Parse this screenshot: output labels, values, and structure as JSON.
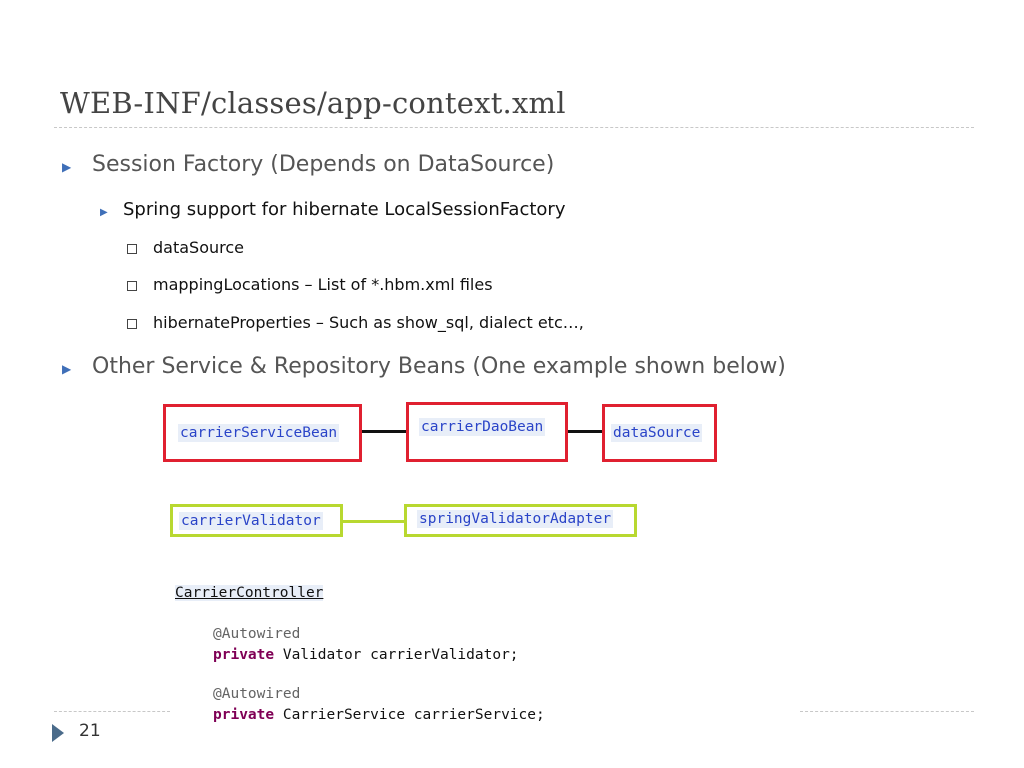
{
  "slide": {
    "title": "WEB-INF/classes/app-context.xml",
    "page_number": "21"
  },
  "bullets": [
    {
      "level": 1,
      "text": "Session Factory (Depends on DataSource)"
    },
    {
      "level": 2,
      "text": "Spring support for hibernate LocalSessionFactory"
    },
    {
      "level": 3,
      "text": "dataSource"
    },
    {
      "level": 3,
      "text": "mappingLocations – List of *.hbm.xml files"
    },
    {
      "level": 3,
      "text": "hibernateProperties – Such as show_sql, dialect etc…,"
    },
    {
      "level": 1,
      "text": "Other Service & Repository Beans (One example shown below)"
    }
  ],
  "diagram": {
    "red_beans": [
      "carrierServiceBean",
      "carrierDaoBean",
      "dataSource"
    ],
    "green_beans": [
      "carrierValidator",
      "springValidatorAdapter"
    ],
    "colors": {
      "red_border": "#e02030",
      "green_border": "#b8d830",
      "bean_text": "#2a44c8"
    }
  },
  "code": {
    "class_name": "CarrierController",
    "annotation": "@Autowired",
    "keyword": "private",
    "field1_type_name": " Validator carrierValidator;",
    "field2_type_name": " CarrierService carrierService;"
  }
}
